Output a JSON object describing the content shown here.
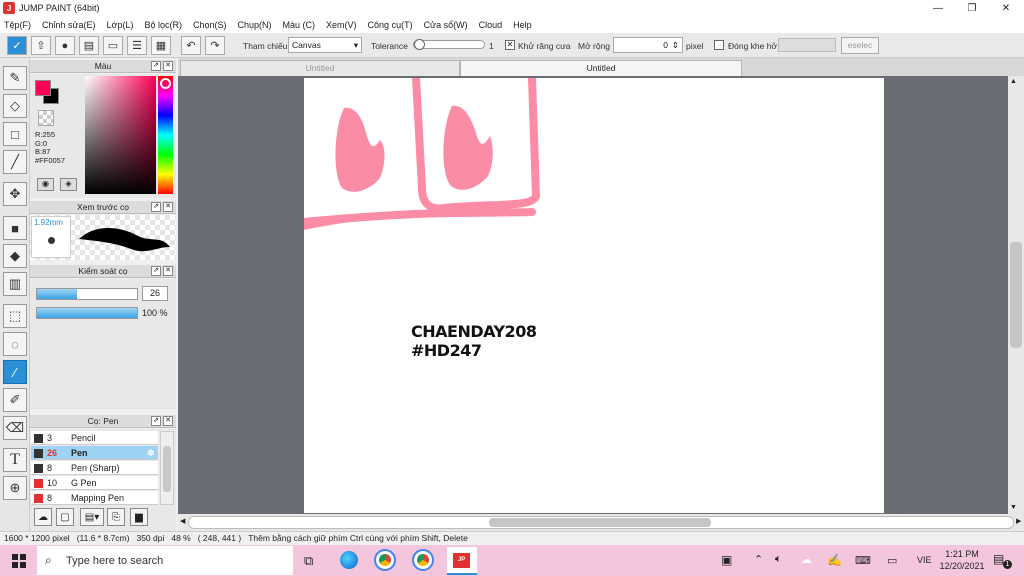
{
  "window": {
    "title": "JUMP PAINT (64bit)",
    "app_initials": "J"
  },
  "menu": [
    "Tệp(F)",
    "Chỉnh sửa(E)",
    "Lớp(L)",
    "Bộ lọc(R)",
    "Chọn(S)",
    "Chụp(N)",
    "Màu (C)",
    "Xem(V)",
    "Công cụ(T)",
    "Cửa sổ(W)",
    "Cloud",
    "Help"
  ],
  "toolbar": {
    "reference_label": "Tham chiếu",
    "reference_value": "Canvas",
    "tolerance_label": "Tolerance",
    "tolerance_value": "1",
    "antialias_label": "Khử răng cưa",
    "expand_label": "Mở rộng",
    "expand_value": "0",
    "pixel_label": "pixel",
    "close_gap_label": "Đóng khe hở",
    "deselect_label": "eselec"
  },
  "color_panel": {
    "title": "Màu",
    "r": "R:255",
    "g": "G:0",
    "b": "B:87",
    "hex": "#FF0057",
    "fg": "#ff0057",
    "bg": "#000000"
  },
  "preview_panel": {
    "title": "Xem trước cọ",
    "size": "1.92mm"
  },
  "control_panel": {
    "title": "Kiểm soát cọ",
    "size_value": "26",
    "opacity_value": "100 %",
    "size_fraction": 0.4,
    "opacity_fraction": 1.0
  },
  "brush_panel": {
    "title": "Cọ: Pen",
    "brushes": [
      {
        "size": "3",
        "name": "Pencil",
        "color": "#333333"
      },
      {
        "size": "26",
        "name": "Pen",
        "color": "#333333"
      },
      {
        "size": "8",
        "name": "Pen (Sharp)",
        "color": "#333333"
      },
      {
        "size": "10",
        "name": "G Pen",
        "color": "#e03030"
      },
      {
        "size": "8",
        "name": "Mapping Pen",
        "color": "#e03030"
      }
    ]
  },
  "tabs": [
    "Untitled",
    "Untitled"
  ],
  "canvas_text": {
    "line1": "CHAENDAY208",
    "line2": "#HD247"
  },
  "status": {
    "size": "1600 * 1200 pixel",
    "mm": "(11.6 * 8.7cm)",
    "dpi": "350 dpi",
    "zoom": "48 %",
    "coords": "( 248, 441 )",
    "hint": "Thêm bằng cách giữ phím Ctrl cùng với phím Shift, Delete"
  },
  "taskbar": {
    "search_placeholder": "Type here to search",
    "lang": "VIE",
    "time": "1:21 PM",
    "date": "12/20/2021",
    "notif_count": "1"
  }
}
